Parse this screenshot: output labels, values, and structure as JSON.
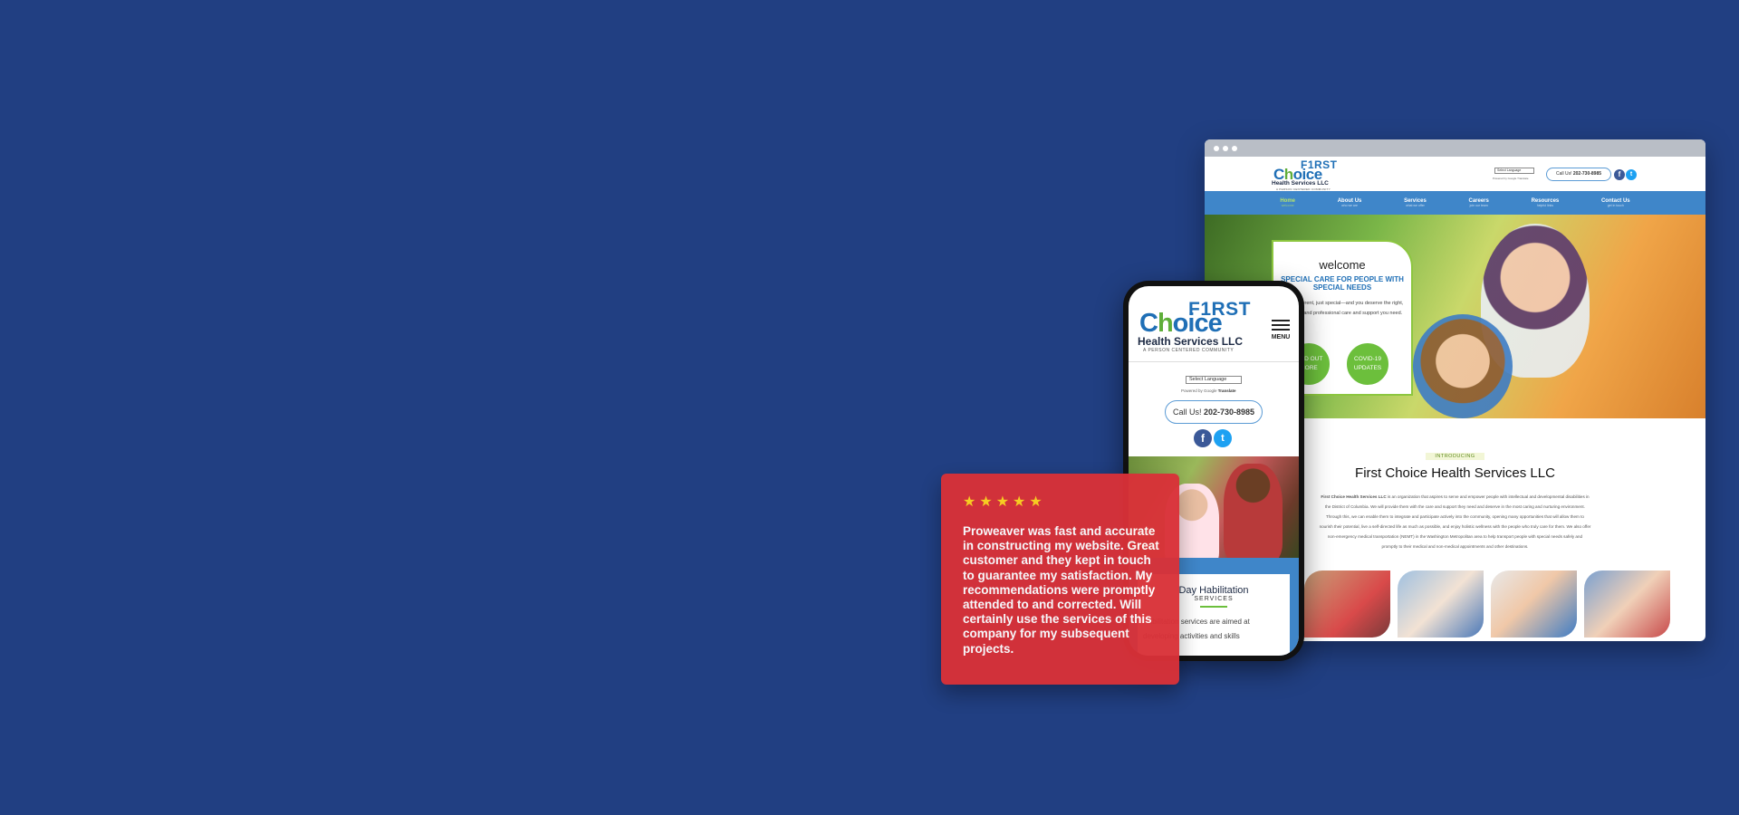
{
  "colors": {
    "background": "#213f82",
    "review_card": "#d93138",
    "star": "#ffd21f",
    "brand_blue": "#1f6fb6",
    "brand_green": "#5fae3a",
    "nav_blue": "#3f86c9"
  },
  "logo": {
    "first": "F1RST",
    "choice_pre": "C",
    "choice_o": "h",
    "choice_post": "oice",
    "company": "Health Services LLC",
    "tagline": "A PERSON CENTERED COMMUNITY"
  },
  "desktop": {
    "language_select": "Select Language",
    "translate": "Powered by Google Translate",
    "call_label": "Call Us!",
    "phone": "202-730-8985",
    "facebook_icon": "f",
    "twitter_icon": "t",
    "nav": [
      {
        "label": "Home",
        "sub": "welcome"
      },
      {
        "label": "About Us",
        "sub": "who we are"
      },
      {
        "label": "Services",
        "sub": "what we offer"
      },
      {
        "label": "Careers",
        "sub": "join our team"
      },
      {
        "label": "Resources",
        "sub": "helpful links"
      },
      {
        "label": "Contact Us",
        "sub": "get in touch"
      }
    ],
    "welcome": {
      "title": "welcome",
      "subtitle": "SPECIAL CARE FOR PEOPLE WITH SPECIAL NEEDS",
      "body": "Being different, just special—and you deserve the right, dignified, and professional care and support you need.",
      "btn_find_out": "FIND OUT MORE",
      "btn_covid": "COVID-19 UPDATES"
    },
    "intro": {
      "tag": "INTRODUCING",
      "title": "First Choice Health Services LLC",
      "company_bold": "First Choice Health Services LLC",
      "body": " is an organization that aspires to serve and empower people with intellectual and developmental disabilities in the District of Columbia. We will provide them with the care and support they need and deserve in the most caring and nurturing environment. Through this, we can enable them to integrate and participate actively into the community, opening many opportunities that will allow them to nourish their potential, live a self-directed life as much as possible, and enjoy holistic wellness with the people who truly care for them. We also offer non-emergency medical transportation (NEMT) in the Washington Metropolitan area to help transport people with special needs safely and promptly to their medical and non-medical appointments and other destinations."
    }
  },
  "mobile": {
    "menu_label": "MENU",
    "language_select": "Select Language",
    "translate_pre": "Powered by Google ",
    "translate_bold": "Translate",
    "call_label": "Call Us!",
    "phone": "202-730-8985",
    "facebook_icon": "f",
    "twitter_icon": "t",
    "card_title": "Day Habilitation",
    "card_sub": "SERVICES",
    "card_body_1": "Habilitation services are aimed at",
    "card_body_2": "developing activities and skills"
  },
  "review": {
    "stars": 5,
    "star_glyph": "★",
    "text": "Proweaver was fast and accurate in constructing my website. Great customer and they kept in touch to guarantee my satisfaction. My recommendations were promptly attended to and corrected. Will certainly use the services of this company for my subsequent projects."
  }
}
